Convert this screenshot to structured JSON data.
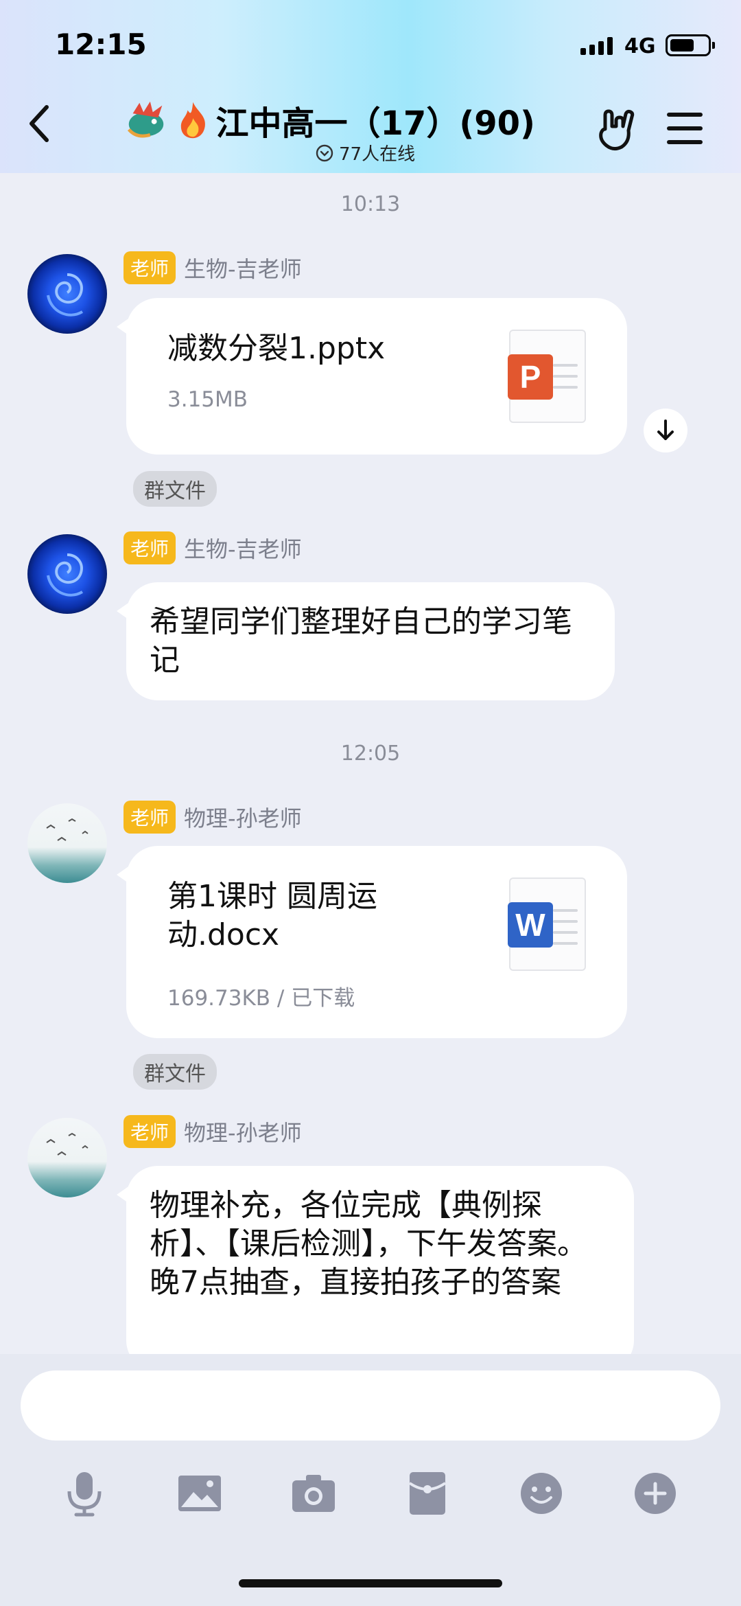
{
  "status_bar": {
    "time": "12:15",
    "network": "4G"
  },
  "header": {
    "title": "江中高一（17）(90)",
    "online_count": "77人在线"
  },
  "messages": [
    {
      "timestamp": "10:13"
    },
    {
      "badge": "老师",
      "sender": "生物-吉老师",
      "file_name": "减数分裂1.pptx",
      "file_size": "3.15MB",
      "file_type_letter": "P",
      "tag": "群文件"
    },
    {
      "badge": "老师",
      "sender": "生物-吉老师",
      "text": "希望同学们整理好自己的学习笔记"
    },
    {
      "timestamp": "12:05"
    },
    {
      "badge": "老师",
      "sender": "物理-孙老师",
      "file_name": "第1课时  圆周运动.docx",
      "file_size": "169.73KB / 已下载",
      "file_type_letter": "W",
      "tag": "群文件"
    },
    {
      "badge": "老师",
      "sender": "物理-孙老师",
      "text": "物理补充，各位完成【典例探析】、【课后检测】，下午发答案。晚7点抽查，直接拍孩子的答案"
    }
  ],
  "colors": {
    "teacher_badge": "#f6b81c",
    "ppt": "#e2572f",
    "word": "#2f64c7",
    "background": "#eceef6"
  },
  "icons": [
    "back-icon",
    "hand-gesture-icon",
    "menu-icon",
    "download-icon",
    "microphone-icon",
    "image-icon",
    "camera-icon",
    "red-packet-icon",
    "emoji-icon",
    "plus-icon"
  ]
}
